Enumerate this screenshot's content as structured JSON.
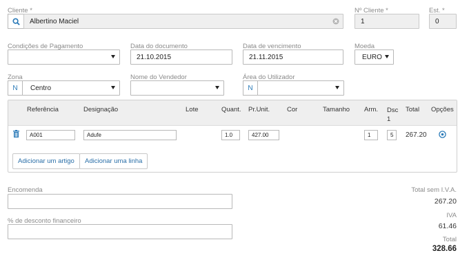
{
  "header": {
    "cliente_label": "Cliente *",
    "cliente_value": "Albertino Maciel",
    "num_cliente_label": "Nº Cliente *",
    "num_cliente_value": "1",
    "est_label": "Est. *",
    "est_value": "0"
  },
  "row2": {
    "condicoes_label": "Condições de Pagamento",
    "condicoes_value": "",
    "data_doc_label": "Data do documento",
    "data_doc_value": "21.10.2015",
    "data_venc_label": "Data de vencimento",
    "data_venc_value": "21.11.2015",
    "moeda_label": "Moeda",
    "moeda_value": "EURO"
  },
  "row3": {
    "zona_label": "Zona",
    "zona_prefix": "N",
    "zona_value": "Centro",
    "vendedor_label": "Nome do Vendedor",
    "vendedor_value": "",
    "area_label": "Área do Utilizador",
    "area_prefix": "N",
    "area_value": ""
  },
  "grid": {
    "columns": {
      "referencia": "Referência",
      "designacao": "Designação",
      "lote": "Lote",
      "quant": "Quant.",
      "prunit": "Pr.Unit.",
      "cor": "Cor",
      "tamanho": "Tamanho",
      "arm": "Arm.",
      "dsc": "Dsc 1",
      "total": "Total",
      "opcoes": "Opções"
    },
    "rows": [
      {
        "referencia": "A001",
        "designacao": "Adufe",
        "quant": "1.0",
        "prunit": "427.00",
        "arm": "1",
        "dsc": "5",
        "total": "267.20"
      }
    ],
    "add_article_label": "Adicionar um artigo",
    "add_line_label": "Adicionar uma linha"
  },
  "footer": {
    "encomenda_label": "Encomenda",
    "encomenda_value": "",
    "desconto_label": "% de desconto financeiro",
    "desconto_value": ""
  },
  "totals": {
    "sem_iva_label": "Total sem I.V.A.",
    "sem_iva_value": "267.20",
    "iva_label": "IVA",
    "iva_value": "61.46",
    "total_label": "Total",
    "total_value": "328.66"
  },
  "colors": {
    "accent": "#2a7ab8",
    "link": "#2a6fa8",
    "label": "#8a8a8a",
    "readonly_bg": "#efefef",
    "grid_header_bg": "#efefef"
  },
  "icons": {
    "search": "search-icon",
    "clear": "clear-circle-icon",
    "delete": "trash-icon",
    "options": "circle-arrow-icon",
    "dropdown": "caret-down-icon"
  }
}
